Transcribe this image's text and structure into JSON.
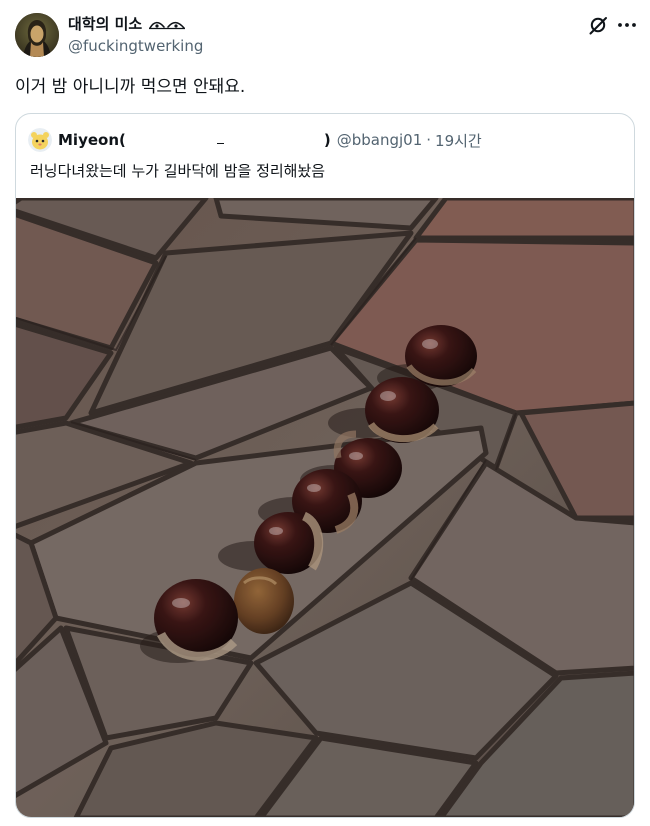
{
  "author": {
    "display_name": "대학의 미소",
    "handle": "@fuckingtwerking"
  },
  "tweet": {
    "text": "이거 밤 아니니까 먹으면 안돼요."
  },
  "quoted_tweet": {
    "display_name_open": "Miyeon(",
    "display_name_close": ")",
    "handle": "@bbangj01",
    "separator": "·",
    "time": "19시간",
    "text": "러닝다녀왔는데 누가 길바닥에 밤을 정리해놨음"
  },
  "icons": {
    "grok": "grok-icon",
    "more": "more-icon",
    "name_decoration": "eyes-emoji-icon"
  },
  "colors": {
    "text_primary": "#0f1419",
    "text_secondary": "#536471",
    "border": "#cfd9de"
  }
}
